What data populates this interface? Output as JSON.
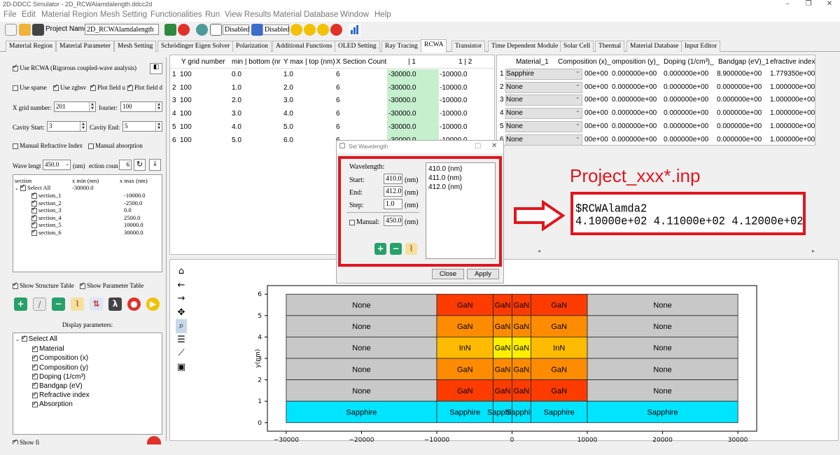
{
  "window": {
    "title": "2D-DDCC Simulator - 2D_RCWAlamdalength.ddcc2d"
  },
  "menu": [
    "File",
    "Edit",
    "Material Region",
    "Mesh Setting",
    "Functionalities",
    "Run",
    "View Results",
    "Material Database",
    "Window",
    "Help"
  ],
  "toolbar": {
    "project_label": "Project Name:",
    "project_name": "2D_RCWAlamdalength",
    "disabled1": "Disabled",
    "disabled2": "Disabled"
  },
  "tabs": [
    "Material Region",
    "Material Parameter",
    "Mesh Setting",
    "Schrödinger Eigen Solver",
    "Polarization",
    "Additional Functions",
    "OLED Setting",
    "Ray Tracing",
    "RCWA",
    "Transistor",
    "Time Dependent Module",
    "Solar Cell",
    "Thermal",
    "Material Database",
    "Input Editor"
  ],
  "left": {
    "use_rcwa": "Use RCWA (Rigorous coupled-wave analysis)",
    "use_sparse": "Use sparse",
    "use_zgbsv": "Use zgbsv",
    "plot_u": "Plot field u",
    "plot_d": "Plot field d",
    "x_grid_label": "X grid number:",
    "x_grid": "201",
    "fourier_label": "fourier:",
    "fourier": "100",
    "cavity_start_label": "Cavity Start:",
    "cavity_start": "3",
    "cavity_end_label": "Cavity End:",
    "cavity_end": "5",
    "manual_ri": "Manual Refractive Index",
    "manual_abs": "Manual absorption",
    "wave_label": "Wave lengt",
    "wave_val": "450.0",
    "nm": "(nm)",
    "section_count_label": "ection coun",
    "section_count": "6",
    "sect_headers": [
      "section",
      "x min (nm)",
      "x max (nm)"
    ],
    "select_all": "Select All",
    "select_all_min": "-30000.0",
    "sections": [
      {
        "n": "section_1",
        "max": "-10000.0"
      },
      {
        "n": "section_2",
        "max": "-2500.0"
      },
      {
        "n": "section_3",
        "max": "0.0"
      },
      {
        "n": "section_4",
        "max": "2500.0"
      },
      {
        "n": "section_5",
        "max": "10000.0"
      },
      {
        "n": "section_6",
        "max": "30000.0"
      }
    ],
    "show_structure": "Show Structure Table",
    "show_parameter": "Show Parameter Table",
    "display_params_title": "Display parameters:",
    "display_select_all": "Select All",
    "display_params": [
      "Material",
      "Composition (x)",
      "Composition (y)",
      "Doping (1/cm³)",
      "Bandgap (eV)",
      "Refractive index",
      "Absorption"
    ],
    "bottom_cut": "Show fi"
  },
  "ytable": {
    "headers": [
      "Y grid number",
      "min | bottom (nr",
      "Y max | top (nm)",
      "X Section Count",
      "| 1",
      "1 | 2"
    ],
    "rows": [
      [
        "1",
        "100",
        "0.0",
        "1.0",
        "6",
        "-30000.0",
        "-10000.0"
      ],
      [
        "2",
        "100",
        "1.0",
        "2.0",
        "6",
        "-30000.0",
        "-10000.0"
      ],
      [
        "3",
        "100",
        "2.0",
        "3.0",
        "6",
        "-30000.0",
        "-10000.0"
      ],
      [
        "4",
        "100",
        "3.0",
        "4.0",
        "6",
        "-30000.0",
        "-10000.0"
      ],
      [
        "5",
        "100",
        "4.0",
        "5.0",
        "6",
        "-30000.0",
        "-10000.0"
      ],
      [
        "6",
        "100",
        "5.0",
        "6.0",
        "6",
        "-30000.0",
        "-10000.0"
      ]
    ]
  },
  "mtable": {
    "headers": [
      "Material_1",
      "Composition (x)_",
      "omposition (y)_",
      "Doping (1/cm³)_",
      "Bandgap (eV)_1",
      "efractive index"
    ],
    "rows": [
      [
        "1",
        "Sapphire",
        "00e+00",
        "0.000000e+00",
        "0.000000e+00",
        "8.900000e+00",
        "1.779350e+00"
      ],
      [
        "2",
        "None",
        "00e+00",
        "0.000000e+00",
        "0.000000e+00",
        "0.000000e+00",
        "1.000000e+00"
      ],
      [
        "3",
        "None",
        "00e+00",
        "0.000000e+00",
        "0.000000e+00",
        "0.000000e+00",
        "1.000000e+00"
      ],
      [
        "4",
        "None",
        "00e+00",
        "0.000000e+00",
        "0.000000e+00",
        "0.000000e+00",
        "1.000000e+00"
      ],
      [
        "5",
        "None",
        "00e+00",
        "0.000000e+00",
        "0.000000e+00",
        "0.000000e+00",
        "1.000000e+00"
      ],
      [
        "6",
        "None",
        "00e+00",
        "0.000000e+00",
        "0.000000e+00",
        "0.000000e+00",
        "1.000000e+00"
      ]
    ]
  },
  "dialog": {
    "title": "Set Wavelength",
    "wavelength": "Wavelength:",
    "start_label": "Start:",
    "start": "410.0",
    "end_label": "End:",
    "end": "412.0",
    "step_label": "Step:",
    "step": "1.0",
    "manual_label": "Manual:",
    "manual": "450.0",
    "nm": "(nm)",
    "list": [
      "410.0 (nm)",
      "411.0 (nm)",
      "412.0 (nm)"
    ],
    "close": "Close",
    "apply": "Apply"
  },
  "annotation": {
    "title": "Project_xxx*.inp",
    "line1": "$RCWAlamda2",
    "line2": "4.10000e+02  4.11000e+02  4.12000e+02"
  },
  "colors": {
    "red_frame": "#e0161f",
    "green_cell": "#c6efce",
    "sapphire": "#00e5ff",
    "none": "#c8c8c8",
    "gan_red": "#ff3c00",
    "gan_orange": "#ff8c00",
    "inn": "#ffbb00",
    "gan_yellow": "#ffee00"
  },
  "plot": {
    "ylabel": "y(nm)",
    "xticks": [
      "−30000",
      "−20000",
      "−10000",
      "0",
      "10000",
      "20000",
      "30000"
    ],
    "yticks": [
      "0",
      "1",
      "2",
      "3",
      "4",
      "5",
      "6"
    ],
    "rows": [
      {
        "y": 5,
        "cells": [
          {
            "t": "None",
            "c": "none"
          },
          {
            "t": "GaN",
            "c": "gan_red"
          },
          {
            "t": "GaN",
            "c": "gan_red"
          },
          {
            "t": "GaN",
            "c": "gan_red"
          },
          {
            "t": "GaN",
            "c": "gan_red"
          },
          {
            "t": "None",
            "c": "none"
          }
        ]
      },
      {
        "y": 4,
        "cells": [
          {
            "t": "None",
            "c": "none"
          },
          {
            "t": "GaN",
            "c": "gan_orange"
          },
          {
            "t": "GaN",
            "c": "gan_orange"
          },
          {
            "t": "GaN",
            "c": "gan_orange"
          },
          {
            "t": "GaN",
            "c": "gan_orange"
          },
          {
            "t": "None",
            "c": "none"
          }
        ]
      },
      {
        "y": 3,
        "cells": [
          {
            "t": "None",
            "c": "none"
          },
          {
            "t": "InN",
            "c": "inn"
          },
          {
            "t": "GaN",
            "c": "gan_yellow"
          },
          {
            "t": "GaN",
            "c": "gan_yellow"
          },
          {
            "t": "InN",
            "c": "inn"
          },
          {
            "t": "None",
            "c": "none"
          }
        ]
      },
      {
        "y": 2,
        "cells": [
          {
            "t": "None",
            "c": "none"
          },
          {
            "t": "GaN",
            "c": "gan_orange"
          },
          {
            "t": "GaN",
            "c": "gan_orange"
          },
          {
            "t": "GaN",
            "c": "gan_orange"
          },
          {
            "t": "GaN",
            "c": "gan_orange"
          },
          {
            "t": "None",
            "c": "none"
          }
        ]
      },
      {
        "y": 1,
        "cells": [
          {
            "t": "None",
            "c": "none"
          },
          {
            "t": "GaN",
            "c": "gan_red"
          },
          {
            "t": "GaN",
            "c": "gan_red"
          },
          {
            "t": "GaN",
            "c": "gan_red"
          },
          {
            "t": "GaN",
            "c": "gan_red"
          },
          {
            "t": "None",
            "c": "none"
          }
        ]
      },
      {
        "y": 0,
        "cells": [
          {
            "t": "Sapphire",
            "c": "sapphire"
          },
          {
            "t": "Sapphire",
            "c": "sapphire"
          },
          {
            "t": "Sapphire",
            "c": "sapphire"
          },
          {
            "t": "Sapphire",
            "c": "sapphire"
          },
          {
            "t": "Sapphire",
            "c": "sapphire"
          },
          {
            "t": "Sapphire",
            "c": "sapphire"
          }
        ]
      }
    ]
  }
}
